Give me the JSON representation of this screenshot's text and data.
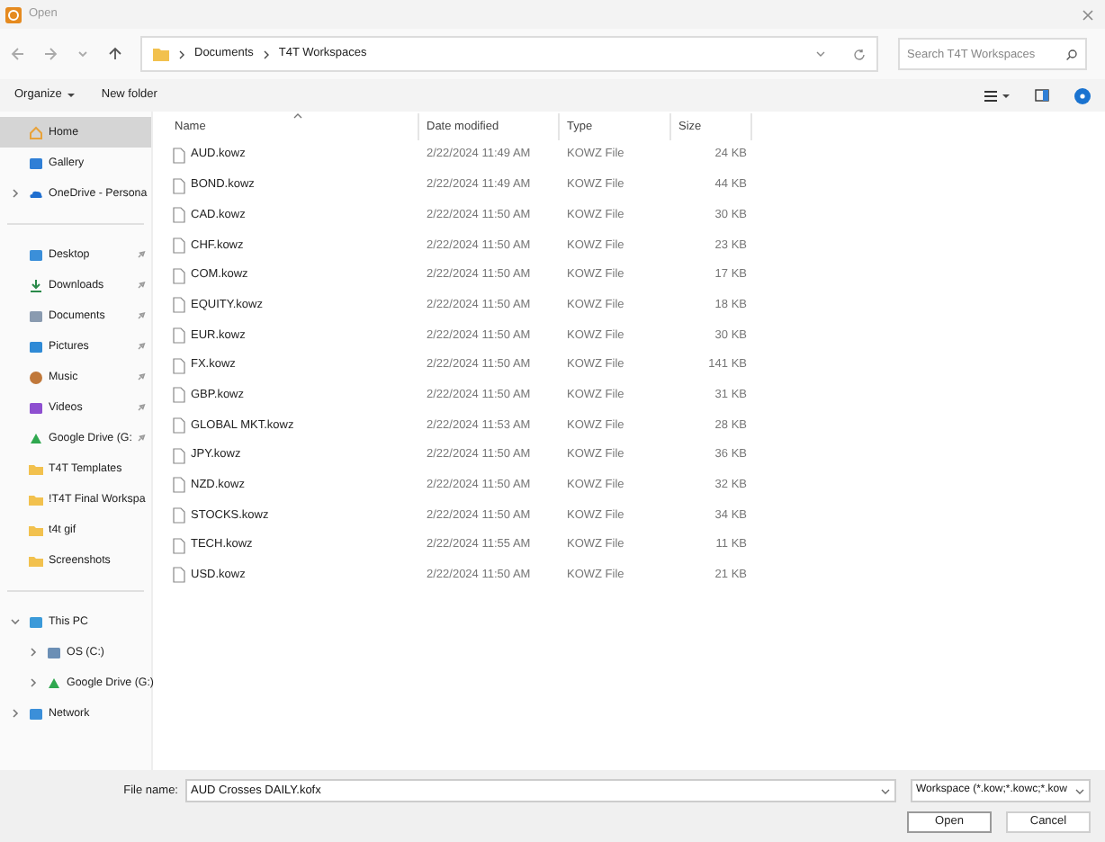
{
  "window": {
    "title": "Open"
  },
  "nav": {
    "path": [
      {
        "label": "Documents"
      },
      {
        "label": "T4T Workspaces"
      }
    ],
    "search": {
      "placeholder": "Search T4T Workspaces"
    }
  },
  "toolbar": {
    "organize": "Organize",
    "new_folder": "New folder"
  },
  "sidebar": {
    "groups": [
      {
        "items": [
          {
            "label": "Home",
            "kind": "home",
            "selected": true,
            "pinned": false
          },
          {
            "label": "Gallery",
            "kind": "gallery",
            "selected": false,
            "pinned": false
          },
          {
            "label": "OneDrive - Persona",
            "kind": "cloud",
            "selected": false,
            "pinned": false,
            "expanded": false
          }
        ]
      },
      {
        "items": [
          {
            "label": "Desktop",
            "kind": "desktop",
            "selected": false,
            "pinned": true
          },
          {
            "label": "Downloads",
            "kind": "download",
            "selected": false,
            "pinned": true
          },
          {
            "label": "Documents",
            "kind": "documents",
            "selected": false,
            "pinned": true
          },
          {
            "label": "Pictures",
            "kind": "pictures",
            "selected": false,
            "pinned": true
          },
          {
            "label": "Music",
            "kind": "music",
            "selected": false,
            "pinned": true
          },
          {
            "label": "Videos",
            "kind": "videos",
            "selected": false,
            "pinned": true
          },
          {
            "label": "Google Drive (G:",
            "kind": "drive",
            "selected": false,
            "pinned": true
          },
          {
            "label": "T4T Templates",
            "kind": "folder",
            "selected": false,
            "pinned": false
          },
          {
            "label": "!T4T Final Workspa",
            "kind": "folder",
            "selected": false,
            "pinned": false
          },
          {
            "label": "t4t gif",
            "kind": "folder",
            "selected": false,
            "pinned": false
          },
          {
            "label": "Screenshots",
            "kind": "folder",
            "selected": false,
            "pinned": false
          }
        ]
      },
      {
        "items": [
          {
            "label": "This PC",
            "kind": "pc",
            "selected": false,
            "pinned": false,
            "expanded": true,
            "children": [
              {
                "label": "OS (C:)",
                "kind": "disk",
                "selected": false,
                "pinned": false,
                "expanded": false
              },
              {
                "label": "Google Drive (G:)",
                "kind": "drive",
                "selected": false,
                "pinned": false,
                "expanded": false
              }
            ]
          },
          {
            "label": "Network",
            "kind": "network",
            "selected": false,
            "pinned": false,
            "expanded": false
          }
        ]
      }
    ]
  },
  "table": {
    "columns": [
      {
        "label": "Name",
        "sorted": true
      },
      {
        "label": "Date modified",
        "sorted": false
      },
      {
        "label": "Type",
        "sorted": false
      },
      {
        "label": "Size",
        "sorted": false
      }
    ],
    "rows": [
      {
        "name": "AUD.kowz",
        "date": "2/22/2024 11:49 AM",
        "type": "KOWZ File",
        "size": "24 KB"
      },
      {
        "name": "BOND.kowz",
        "date": "2/22/2024 11:49 AM",
        "type": "KOWZ File",
        "size": "44 KB"
      },
      {
        "name": "CAD.kowz",
        "date": "2/22/2024 11:50 AM",
        "type": "KOWZ File",
        "size": "30 KB"
      },
      {
        "name": "CHF.kowz",
        "date": "2/22/2024 11:50 AM",
        "type": "KOWZ File",
        "size": "23 KB"
      },
      {
        "name": "COM.kowz",
        "date": "2/22/2024 11:50 AM",
        "type": "KOWZ File",
        "size": "17 KB"
      },
      {
        "name": "EQUITY.kowz",
        "date": "2/22/2024 11:50 AM",
        "type": "KOWZ File",
        "size": "18 KB"
      },
      {
        "name": "EUR.kowz",
        "date": "2/22/2024 11:50 AM",
        "type": "KOWZ File",
        "size": "30 KB"
      },
      {
        "name": "FX.kowz",
        "date": "2/22/2024 11:50 AM",
        "type": "KOWZ File",
        "size": "141 KB"
      },
      {
        "name": "GBP.kowz",
        "date": "2/22/2024 11:50 AM",
        "type": "KOWZ File",
        "size": "31 KB"
      },
      {
        "name": "GLOBAL MKT.kowz",
        "date": "2/22/2024 11:53 AM",
        "type": "KOWZ File",
        "size": "28 KB"
      },
      {
        "name": "JPY.kowz",
        "date": "2/22/2024 11:50 AM",
        "type": "KOWZ File",
        "size": "36 KB"
      },
      {
        "name": "NZD.kowz",
        "date": "2/22/2024 11:50 AM",
        "type": "KOWZ File",
        "size": "32 KB"
      },
      {
        "name": "STOCKS.kowz",
        "date": "2/22/2024 11:50 AM",
        "type": "KOWZ File",
        "size": "34 KB"
      },
      {
        "name": "TECH.kowz",
        "date": "2/22/2024 11:55 AM",
        "type": "KOWZ File",
        "size": "11 KB"
      },
      {
        "name": "USD.kowz",
        "date": "2/22/2024 11:50 AM",
        "type": "KOWZ File",
        "size": "21 KB"
      }
    ]
  },
  "footer": {
    "file_name_label": "File name:",
    "file_name": "AUD Crosses DAILY.kofx",
    "filter": "Workspace (*.kow;*.kowc;*.kow",
    "buttons": [
      {
        "label": "Open",
        "kind": "primary"
      },
      {
        "label": "Cancel",
        "kind": "secondary"
      }
    ]
  }
}
